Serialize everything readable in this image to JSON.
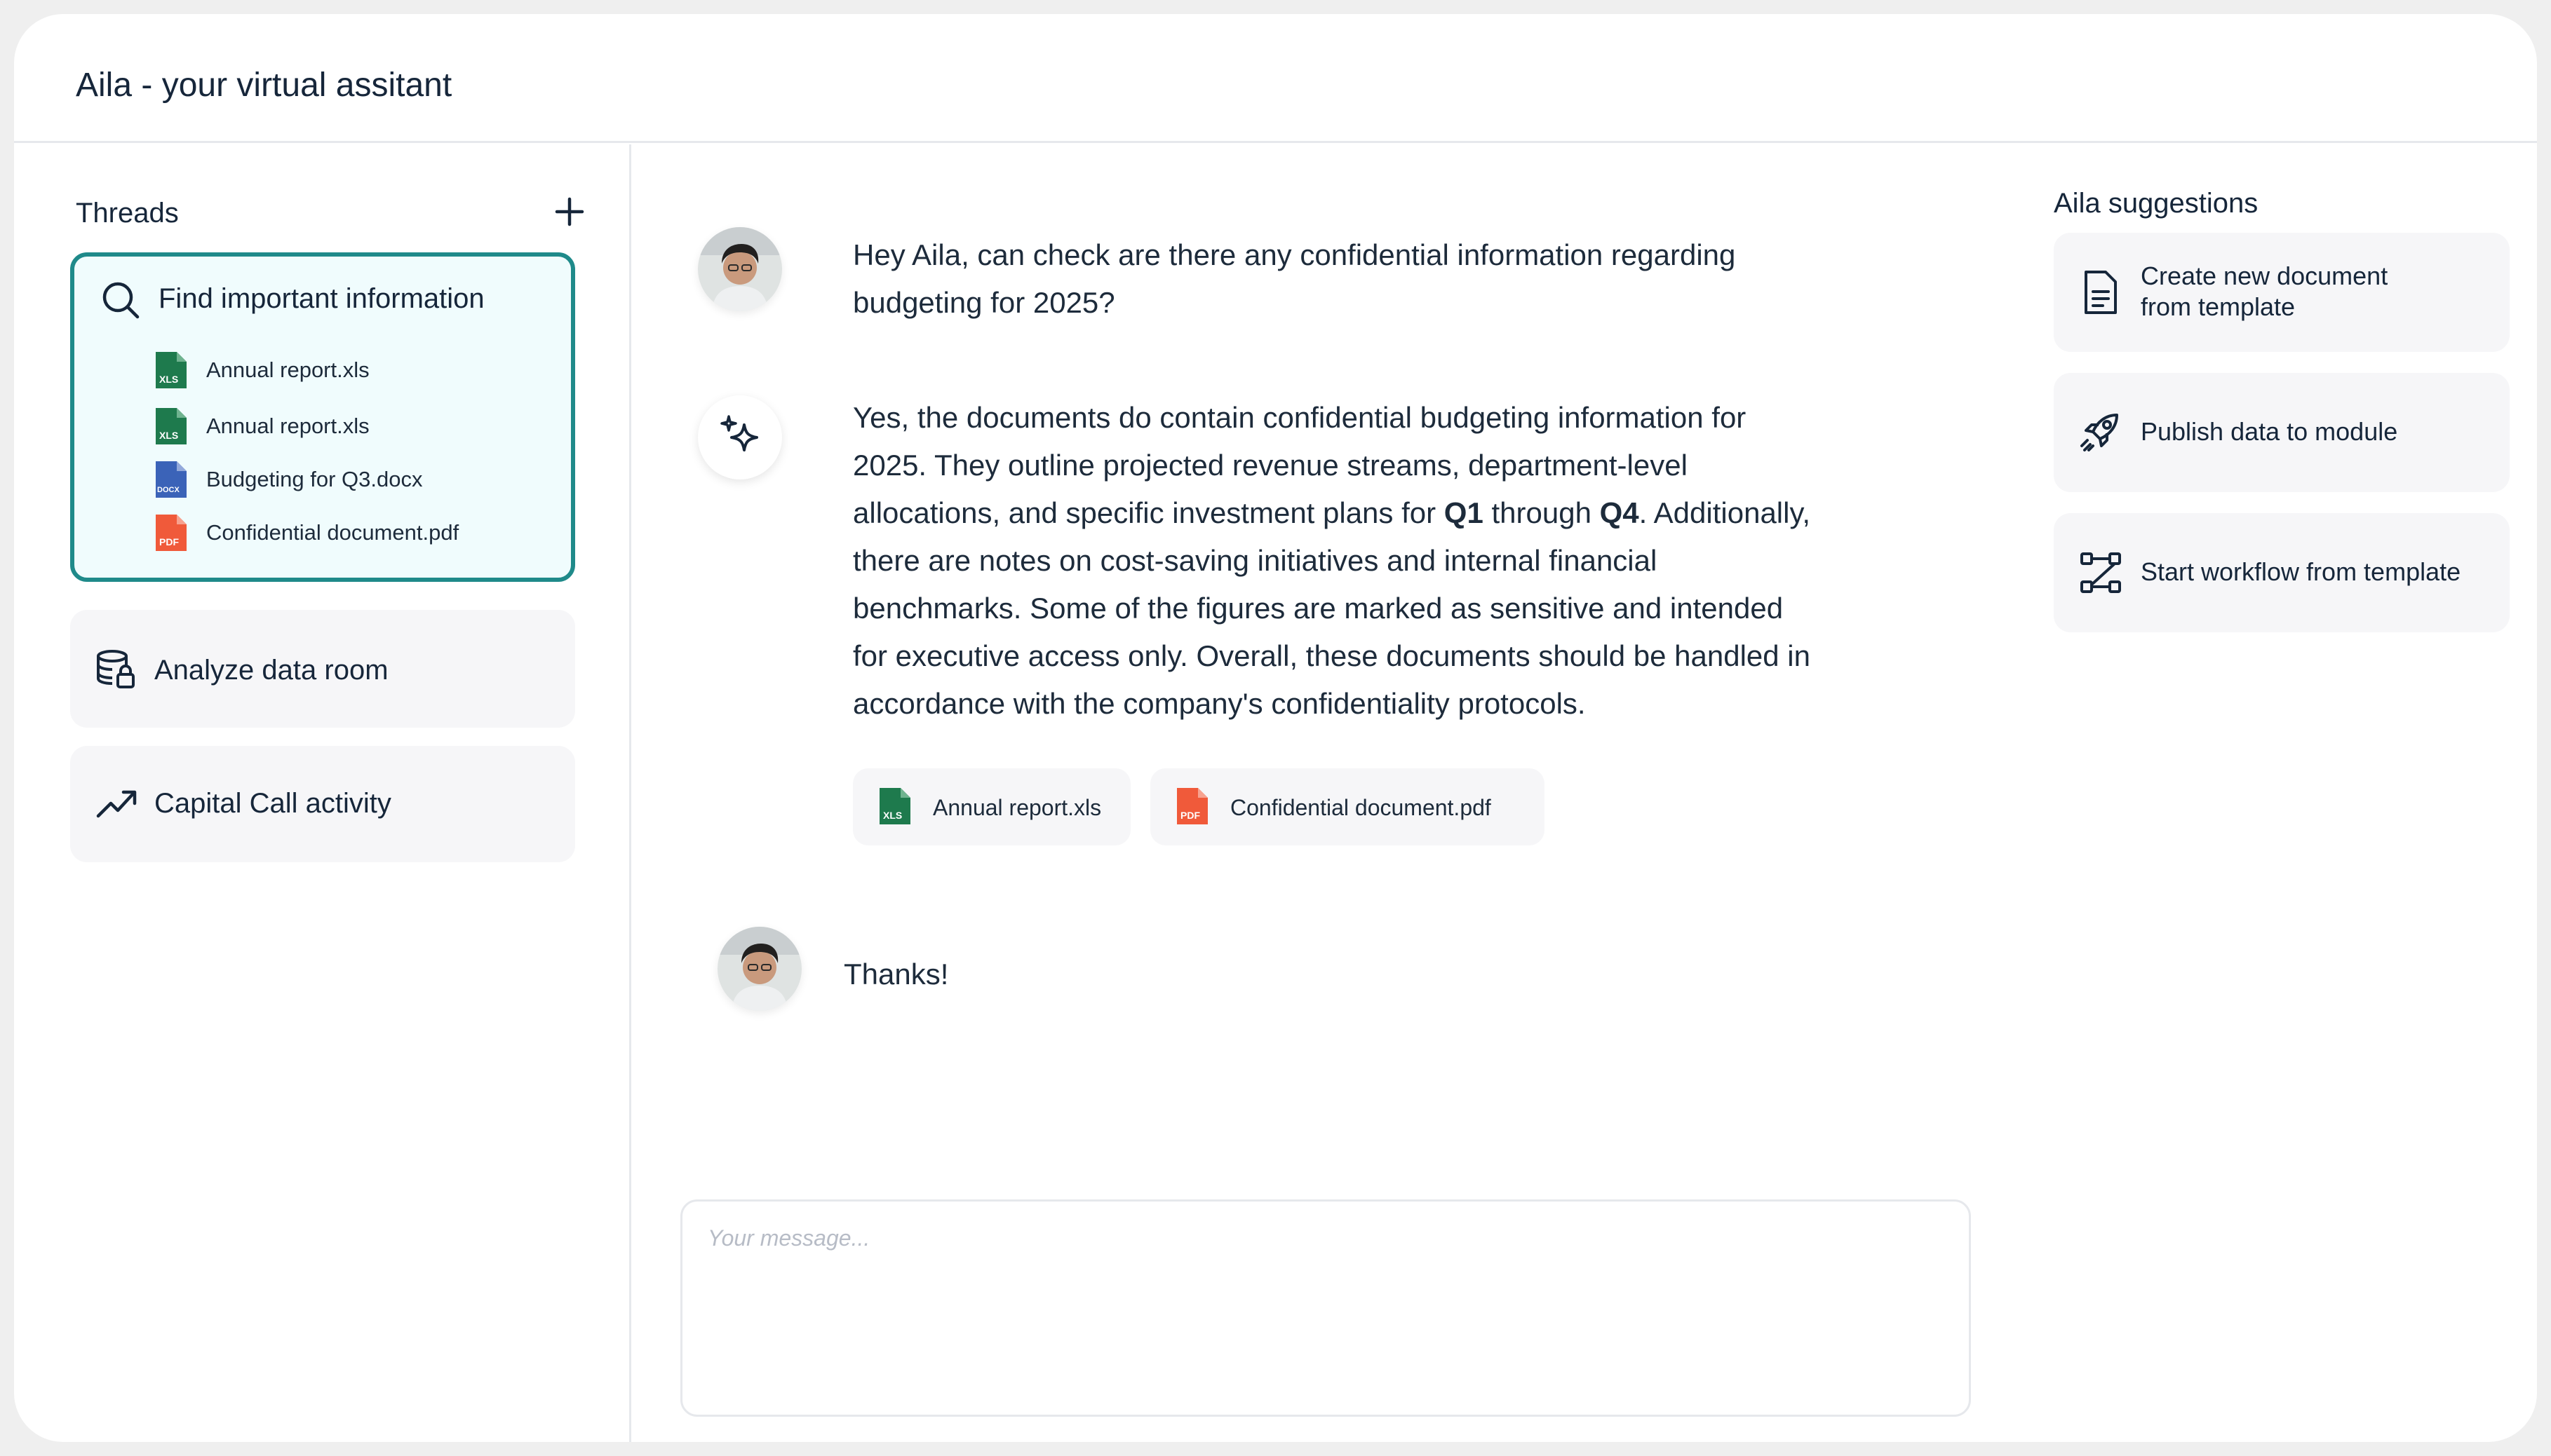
{
  "app": {
    "title": "Aila - your virtual assitant"
  },
  "sidebar": {
    "threads_label": "Threads",
    "threads": [
      {
        "title": "Find important information",
        "files": [
          {
            "name": "Annual report.xls",
            "type": "XLS"
          },
          {
            "name": "Annual report.xls",
            "type": "XLS"
          },
          {
            "name": "Budgeting for Q3.docx",
            "type": "DOCX"
          },
          {
            "name": "Confidential document.pdf",
            "type": "PDF"
          }
        ]
      },
      {
        "title": "Analyze data room"
      },
      {
        "title": "Capital Call activity"
      }
    ]
  },
  "chat": {
    "messages": [
      {
        "role": "user",
        "text": "Hey Aila, can check are there any confidential information regarding budgeting for 2025?"
      },
      {
        "role": "assistant",
        "text_parts": [
          "Yes, the documents do contain confidential budgeting information for 2025. They outline projected revenue streams, department-level allocations, and specific investment plans for ",
          "Q1",
          " through ",
          "Q4",
          ". Additionally, there are notes on cost-saving initiatives and internal financial benchmarks. Some of the figures are marked as sensitive and intended for executive access only. Overall, these documents should be handled in accordance with the company's confidentiality protocols."
        ],
        "attachments": [
          {
            "name": "Annual report.xls",
            "type": "XLS"
          },
          {
            "name": "Confidential document.pdf",
            "type": "PDF"
          }
        ]
      },
      {
        "role": "user",
        "text": "Thanks!"
      }
    ],
    "composer": {
      "placeholder": "Your message..."
    }
  },
  "suggestions": {
    "title": "Aila suggestions",
    "items": [
      {
        "line1": "Create new document",
        "line2": "from template",
        "icon": "document-icon"
      },
      {
        "line1": "Publish data to module",
        "icon": "rocket-icon"
      },
      {
        "line1": "Start workflow from template",
        "icon": "workflow-icon"
      }
    ]
  },
  "colors": {
    "accent": "#1f8a8a",
    "xls": "#1e7a4d",
    "docx": "#3b63b8",
    "pdf": "#f05a3a"
  }
}
